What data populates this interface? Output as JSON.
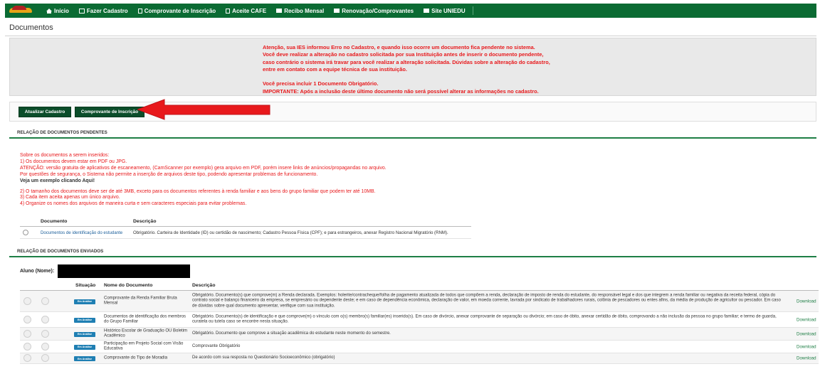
{
  "nav": {
    "items": [
      {
        "label": "Início",
        "icon": "home-icon"
      },
      {
        "label": "Fazer Cadastro",
        "icon": "edit-icon"
      },
      {
        "label": "Comprovante de Inscrição",
        "icon": "file-icon"
      },
      {
        "label": "Aceite CAFE",
        "icon": "file-icon"
      },
      {
        "label": "Recibo Mensal",
        "icon": "card-icon"
      },
      {
        "label": "Renovação/Comprovantes",
        "icon": "card-icon"
      },
      {
        "label": "Site UNIEDU",
        "icon": "card-icon"
      }
    ],
    "color": "#0b6b33"
  },
  "page": {
    "title": "Documentos"
  },
  "alert": {
    "lines": [
      "Atenção, sua IES informou Erro no Cadastro, e quando isso ocorre um documento fica pendente no sistema.",
      "Você deve realizar a alteração no cadastro solicitada por sua Instituição antes de inserir o documento pendente,",
      "caso contrário o sistema irá travar para você realizar a alteração solicitada. Dúvidas sobre a alteração do cadastro,",
      "entre em contato com a equipe técnica de sua instituição.",
      "Você precisa incluir 1 Documento Obrigatório.",
      "IMPORTANTE: Após a inclusão deste último documento não será possível alterar as informações no cadastro."
    ],
    "color": "#e8191c"
  },
  "buttons": {
    "atualizar": "Atualizar Cadastro",
    "comprovante": "Comprovante de Inscrição"
  },
  "pending": {
    "header": "RELAÇÃO DE DOCUMENTOS PENDENTES",
    "info": [
      "Sobre os documentos a serem inseridos:",
      "1) Os documentos devem estar em PDF ou JPG.",
      "ATENÇÃO: versão gratuita de aplicativos de escaneamento, (CamScanner por exemplo) gera arquivo em PDF, porém insere links de anúncios/propagandas no arquivo.",
      "Por questões de segurança, o Sistema não permite a inserção de arquivos deste tipo, podendo apresentar problemas de funcionamento.",
      "Veja um exemplo clicando Aqui!",
      "2) O tamanho dos documentos deve ser de até 3MB, exceto para os documentos referentes à renda familiar e aos bens do grupo familiar que podem ter até 10MB.",
      "3) Cada item aceita apenas um único arquivo.",
      "4) Organize os nomes dos arquivos de maneira curta e sem caracteres especiais para evitar problemas."
    ],
    "columns": [
      "Documento",
      "Descrição"
    ],
    "rows": [
      {
        "document": "Documentos de identificação do estudante",
        "description": "Obrigatório. Carteira de Identidade (ID) ou certidão de nascimento; Cadastro Pessoa Física (CPF); e para estrangeiros, anexar Registro Nacional Migratório (RNM)."
      }
    ]
  },
  "sent": {
    "header": "RELAÇÃO DE DOCUMENTOS ENVIADOS",
    "aluno_label": "Aluno (Nome):",
    "columns": [
      "Situação",
      "Nome do Documento",
      "Descrição"
    ],
    "rows": [
      {
        "status": "Em Análise",
        "name": "Comprovante da Renda Familiar Bruta Mensal",
        "description": "Obrigatório. Documento(s) que comprove(m) a Renda declarada. Exemplos: holerite/contracheque/folha de pagamento atualizada de todos que compõem a renda, declaração de imposto de renda do estudante, do responsável legal e dos que integrem a renda familiar ou negativa da receita federal, cópia do contrato social e balanço financeiro da empresa, se empresário ou dependente deste; e em caso de dependência econômica, declaração de valor, em moeda corrente, lavrada por sindicato de trabalhadores rurais, colônia de pescadores ou entes afins, da média de produção de agricultor ou pescador. Em caso de dúvidas sobre qual documento apresentar, verifique com sua instituição.",
        "action": "Download"
      },
      {
        "status": "Em Análise",
        "name": "Documentos de identificação dos membros do Grupo Familiar",
        "description": "Obrigatório. Documento(s) de identificação e que comprove(m) o vínculo com o(s) membro(s) familiar(es) inserido(s). Em caso de divórcio, anexar comprovante de separação ou divórcio; em caso de óbito, anexar certidão de óbito, comprovando a não inclusão da pessoa no grupo familiar; e termo de guarda, curatela ou tutela caso se encontre nesta situação.",
        "action": "Download"
      },
      {
        "status": "Em Análise",
        "name": "Histórico Escolar de Graduação OU Boletim Acadêmico",
        "description": "Obrigatório. Documento que comprove a situação acadêmica do estudante neste momento do semestre.",
        "action": "Download"
      },
      {
        "status": "Em Análise",
        "name": "Participação em Projeto Social com Visão Educativa",
        "description": "Comprovante Obrigatório",
        "action": "Download"
      },
      {
        "status": "Em Análise",
        "name": "Comprovante do Tipo de Moradia",
        "description": "De acordo com sua resposta no Questionário Socioeconômico (obrigatório)",
        "action": "Download"
      }
    ],
    "badge_color": "#1f7fb3"
  },
  "annotation": {
    "arrow_color": "#e8191c"
  }
}
